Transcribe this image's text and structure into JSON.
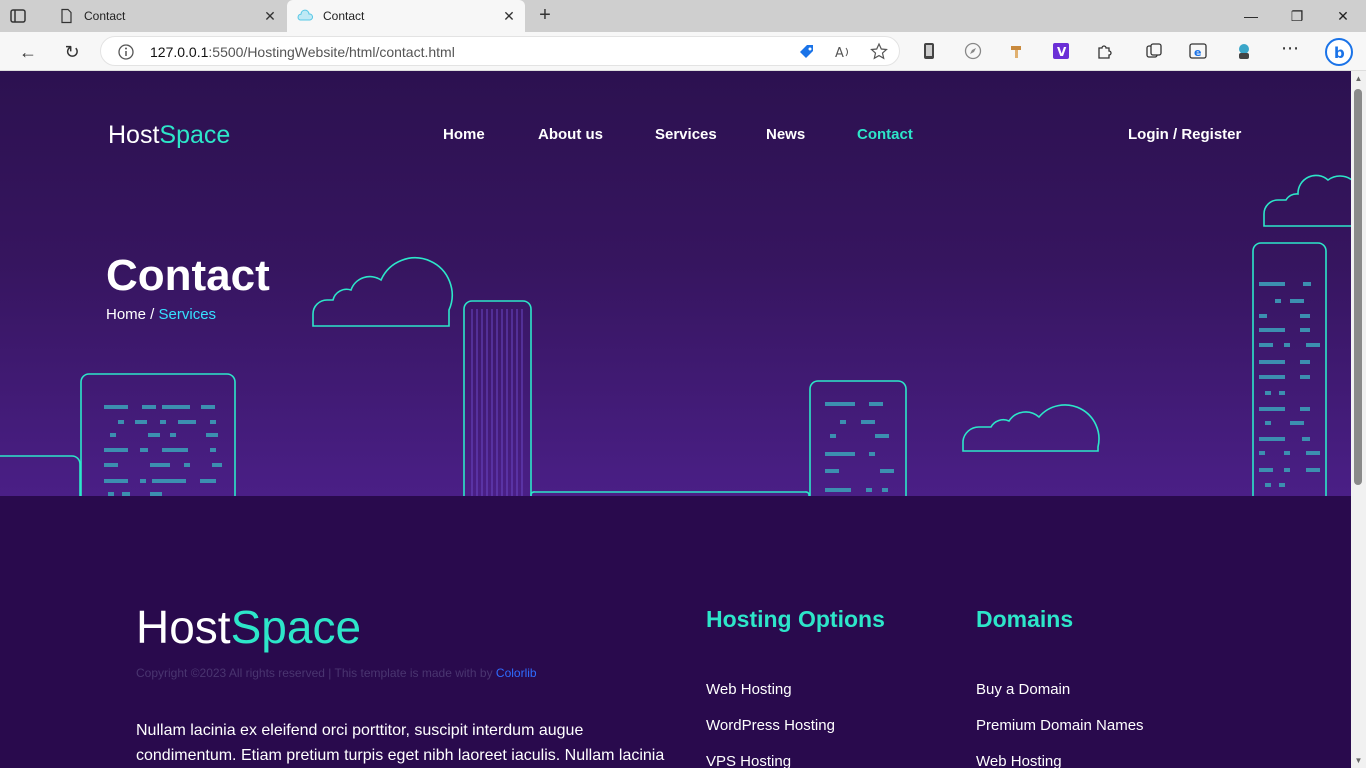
{
  "browser": {
    "tabs": [
      {
        "title": "Contact",
        "active": false
      },
      {
        "title": "Contact",
        "active": true
      }
    ],
    "url_host": "127.0.0.1",
    "url_rest": ":5500/HostingWebsite/html/contact.html"
  },
  "header": {
    "logo_main": "Host",
    "logo_accent": "Space",
    "nav": [
      {
        "label": "Home",
        "active": false
      },
      {
        "label": "About us",
        "active": false
      },
      {
        "label": "Services",
        "active": false
      },
      {
        "label": "News",
        "active": false
      },
      {
        "label": "Contact",
        "active": true
      }
    ],
    "auth": "Login / Register"
  },
  "hero": {
    "title": "Contact",
    "breadcrumb_home": "Home",
    "breadcrumb_sep": " / ",
    "breadcrumb_current": "Services"
  },
  "footer": {
    "logo_main": "Host",
    "logo_accent": "Space",
    "copyright_text": "Copyright ©2023 All rights reserved | This template is made with by ",
    "copyright_link": "Colorlib",
    "paragraph": "Nullam lacinia ex eleifend orci porttitor, suscipit interdum augue condimentum. Etiam pretium turpis eget nibh laoreet iaculis. Nullam lacinia",
    "hosting_title": "Hosting Options",
    "hosting_links": [
      "Web Hosting",
      "WordPress Hosting",
      "VPS Hosting"
    ],
    "domains_title": "Domains",
    "domain_links": [
      "Buy a Domain",
      "Premium Domain Names",
      "Web Hosting"
    ]
  },
  "colors": {
    "accent": "#2de6c9",
    "hero_top": "#2c1150",
    "hero_bottom": "#4a1f86",
    "footer_bg": "#290a4d",
    "outline": "#2de6c9"
  }
}
